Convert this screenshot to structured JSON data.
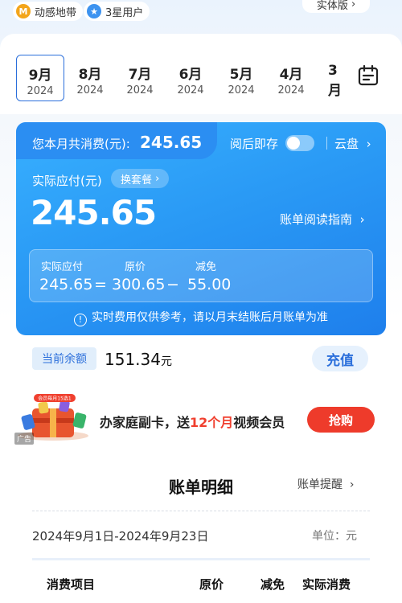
{
  "top": {
    "badge1": {
      "icon": "M",
      "label": "动感地带"
    },
    "badge2": {
      "label": "3星用户"
    },
    "right_button": "实体版"
  },
  "months": [
    {
      "month": "9月",
      "year": "2024",
      "active": true
    },
    {
      "month": "8月",
      "year": "2024"
    },
    {
      "month": "7月",
      "year": "2024"
    },
    {
      "month": "6月",
      "year": "2024"
    },
    {
      "month": "5月",
      "year": "2024"
    },
    {
      "month": "4月",
      "year": "2024"
    },
    {
      "month": "3月",
      "year": "2024"
    }
  ],
  "card": {
    "total_label": "您本月共消费(元):",
    "total_amount": "245.65",
    "toggle_label": "阅后即存",
    "cloud": "云盘",
    "pay_label": "实际应付(元)",
    "plan_button": "换套餐",
    "big_amount": "245.65",
    "guide": "账单阅读指南",
    "breakdown": {
      "label_pay": "实际应付",
      "label_orig": "原价",
      "label_reduce": "减免",
      "pay": "245.65",
      "eq": "=",
      "orig": "300.65",
      "minus": "−",
      "reduce": "55.00"
    },
    "notice": "实时费用仅供参考，请以月末结账后月账单为准"
  },
  "balance": {
    "label": "当前余额",
    "value": "151.34",
    "unit": "元",
    "recharge": "充值"
  },
  "ad": {
    "tag": "广告",
    "text_prefix": "办家庭副卡，送",
    "text_highlight": "12个月",
    "text_suffix": "视频会员",
    "button": "抢购",
    "art_caption": "会员每月15选1"
  },
  "detail": {
    "title": "账单明细",
    "reminder": "账单提醒",
    "date_range": "2024年9月1日-2024年9月23日",
    "unit": "单位：元",
    "headers": [
      "消费项目",
      "原价",
      "减免",
      "实际消费"
    ]
  },
  "colors": {
    "accent": "#2b6fdb",
    "card_blue": "#2a9af5",
    "promo_red": "#ee3b2b"
  }
}
